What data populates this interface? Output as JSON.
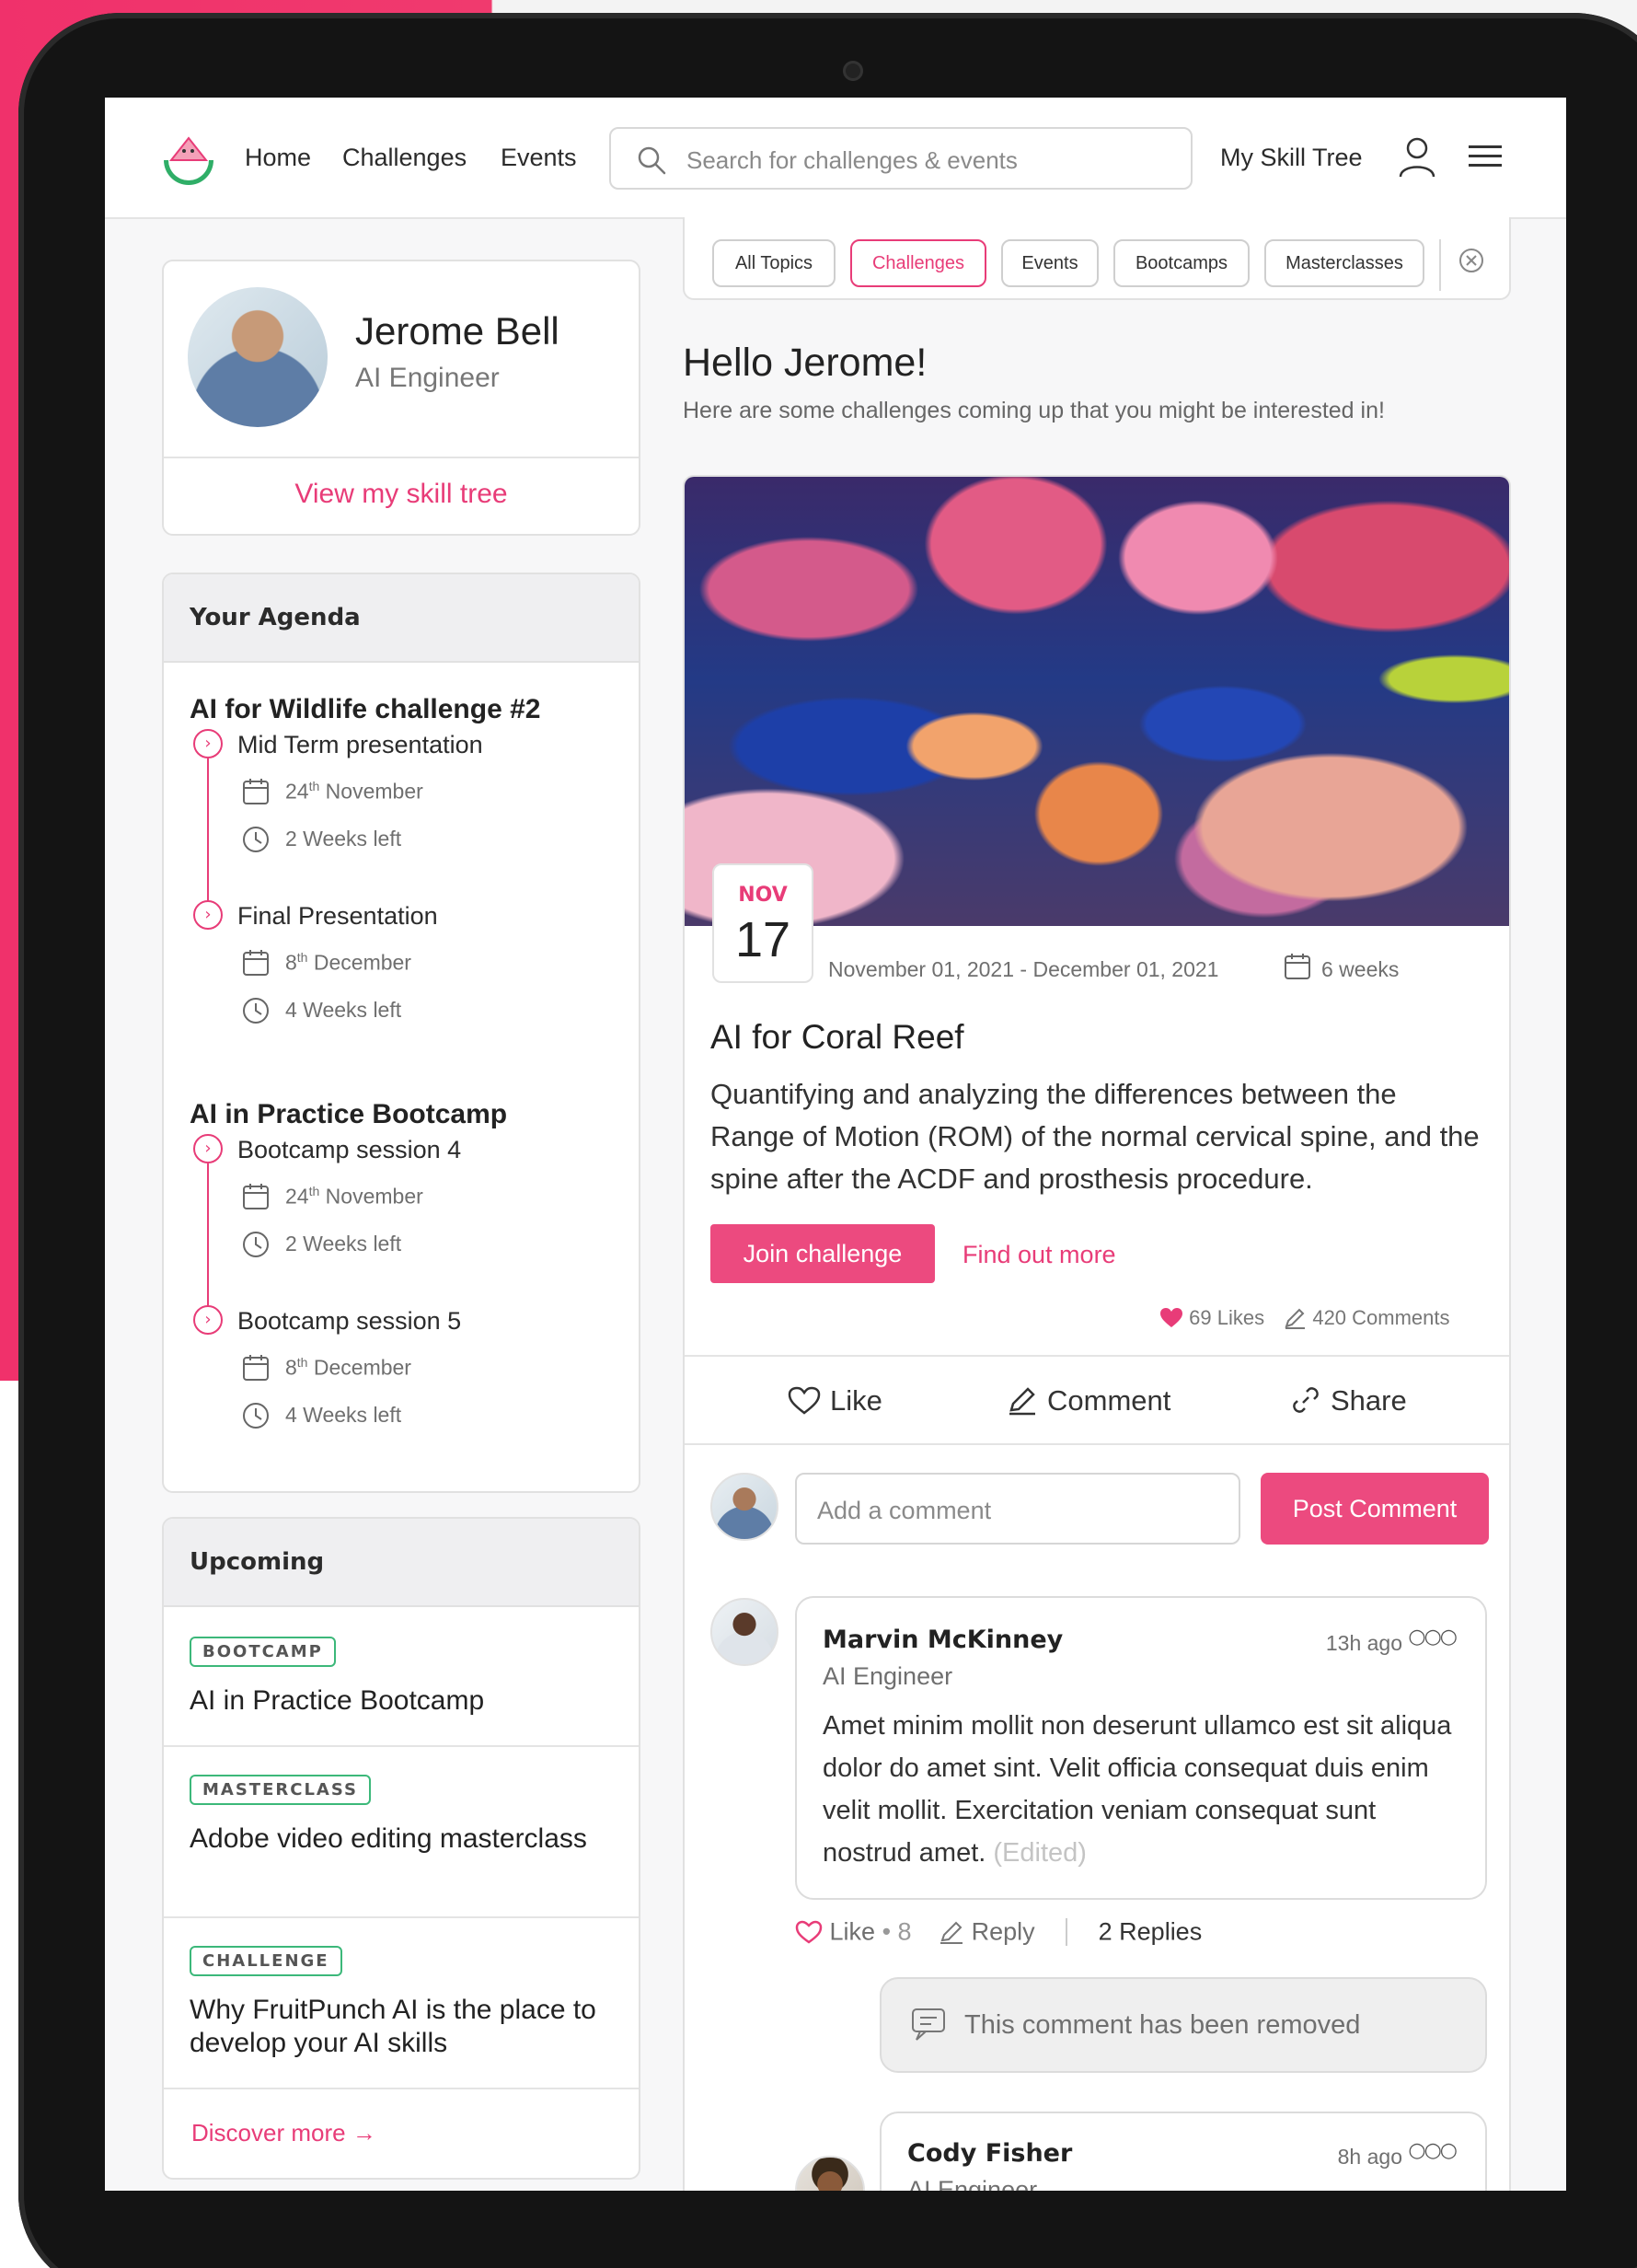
{
  "nav": {
    "links": [
      "Home",
      "Challenges",
      "Events"
    ],
    "search_placeholder": "Search for challenges & events",
    "skill_tree": "My Skill Tree"
  },
  "profile": {
    "name": "Jerome Bell",
    "role": "AI Engineer",
    "skill_tree_link": "View my skill tree"
  },
  "agenda": {
    "title": "Your Agenda",
    "groups": [
      {
        "title": "AI for Wildlife challenge #2",
        "steps": [
          {
            "label": "Mid Term presentation",
            "day": "24",
            "suffix": "th",
            "month": "November",
            "left": "2 Weeks left"
          },
          {
            "label": "Final Presentation",
            "day": "8",
            "suffix": "th",
            "month": "December",
            "left": "4 Weeks left"
          }
        ]
      },
      {
        "title": "AI in Practice Bootcamp",
        "steps": [
          {
            "label": "Bootcamp session 4",
            "day": "24",
            "suffix": "th",
            "month": "November",
            "left": "2 Weeks left"
          },
          {
            "label": "Bootcamp session 5",
            "day": "8",
            "suffix": "th",
            "month": "December",
            "left": "4 Weeks left"
          }
        ]
      }
    ]
  },
  "upcoming": {
    "title": "Upcoming",
    "items": [
      {
        "tag": "BOOTCAMP",
        "title": "AI in Practice Bootcamp"
      },
      {
        "tag": "MASTERCLASS",
        "title": "Adobe video editing masterclass"
      },
      {
        "tag": "CHALLENGE",
        "title": "Why FruitPunch AI is the place to develop your AI skills"
      }
    ],
    "discover": "Discover more →"
  },
  "filters": {
    "chips": [
      "All Topics",
      "Challenges",
      "Events",
      "Bootcamps",
      "Masterclasses"
    ],
    "active": "Challenges"
  },
  "greeting": {
    "title": "Hello Jerome!",
    "subtitle": "Here are some challenges coming up that you might be interested in!"
  },
  "post": {
    "month": "NOV",
    "day": "17",
    "range": "November 01, 2021 - December 01, 2021",
    "duration": "6 weeks",
    "title": "AI for Coral Reef",
    "description": "Quantifying and analyzing the differences between the Range of Motion (ROM) of the normal cervical spine, and the spine after the ACDF and prosthesis procedure.",
    "join": "Join challenge",
    "find_out": "Find out more",
    "likes": "69 Likes",
    "comments": "420 Comments",
    "actions": {
      "like": "Like",
      "comment": "Comment",
      "share": "Share"
    },
    "comment_placeholder": "Add a comment",
    "post_comment": "Post Comment",
    "accent": "#ec4a7f"
  },
  "comments": [
    {
      "name": "Marvin McKinney",
      "role": "AI Engineer",
      "time": "13h ago",
      "body": "Amet minim mollit non deserunt ullamco est sit aliqua dolor do amet sint. Velit officia consequat duis enim velit mollit. Exercitation veniam consequat sunt nostrud amet.",
      "edited": "(Edited)",
      "like": "Like",
      "like_count": "• 8",
      "reply": "Reply",
      "replies": "2 Replies"
    }
  ],
  "removed_text": "This comment has been removed",
  "reply": {
    "name": "Cody Fisher",
    "role": "AI Engineer",
    "time": "8h ago"
  }
}
